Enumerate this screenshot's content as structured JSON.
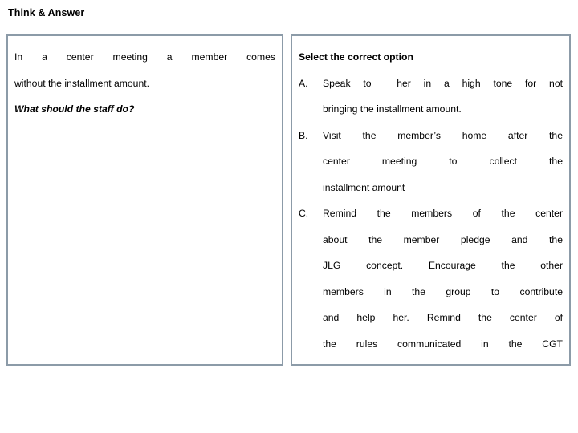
{
  "page": {
    "title": "Think & Answer",
    "background_color": "#ffffff",
    "border_color": "#8c9ba8",
    "text_color": "#000000"
  },
  "scenario_panel": {
    "name": "scenario",
    "lines": [
      "In a center meeting a member comes",
      "without the installment amount.",
      "What should the staff do?"
    ]
  },
  "options_panel": {
    "header": "Select the correct option",
    "options": [
      {
        "letter": "A.",
        "lines": [
          "Speak to  her in a high tone for not",
          "bringing the installment amount."
        ]
      },
      {
        "letter": "B.",
        "lines": [
          "Visit the member’s home after the",
          "center meeting to collect the",
          "installment amount"
        ]
      },
      {
        "letter": "C.",
        "lines": [
          "Remind the members of the center",
          "about the member pledge and the",
          "JLG concept. Encourage the other",
          "members in the group to contribute",
          "and help her. Remind the center of",
          "the rules communicated in the CGT"
        ]
      }
    ]
  }
}
